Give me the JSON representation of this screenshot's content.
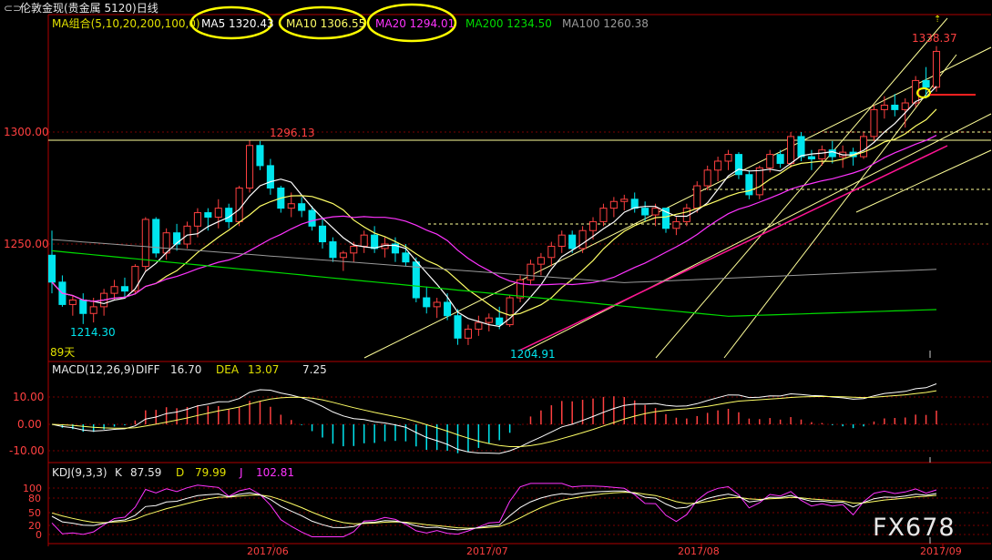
{
  "window": {
    "icon": "link-icon",
    "title": "伦敦金现(贵金属 5120)日线"
  },
  "colors": {
    "up": "#ff4040",
    "down": "#00e5ee",
    "ma5": "#ffffff",
    "ma10": "#ffff66",
    "ma20": "#ff33ff",
    "ma200": "#00dd00",
    "ma100": "#9a9a9a",
    "axis": "#b00000",
    "grid": "#7a0000",
    "hline": "#ffff99",
    "highlight": "#ffff00",
    "watermark": "#e8e8e8"
  },
  "main_panel": {
    "ma_prefix": "MA组合(5,10,20,200,100,0)",
    "ma5_label": "MA5 1320.43",
    "ma10_label": "MA10 1306.55",
    "ma20_label": "MA20 1294.01",
    "ma200_label": "MA200 1234.50",
    "ma100_label": "MA100 1260.38",
    "y_ticks": [
      "1300.00",
      "1250.00"
    ],
    "annotations": {
      "last_high": "1338.37",
      "mid_high": "1296.13",
      "left_low": "1214.30",
      "mid_low": "1204.91",
      "days": "89天",
      "arrow": "⇡"
    }
  },
  "macd_panel": {
    "label": "MACD(12,26,9)",
    "diff_label": "DIFF",
    "diff_value": "16.70",
    "dea_label": "DEA",
    "dea_value": "13.07",
    "macd_value": "7.25",
    "y_ticks": [
      "10.00",
      "0.00",
      "-10.00"
    ]
  },
  "kdj_panel": {
    "label": "KDJ(9,3,3)",
    "k_label": "K",
    "k_value": "87.59",
    "d_label": "D",
    "d_value": "79.99",
    "j_label": "J",
    "j_value": "102.81",
    "y_ticks": [
      "100",
      "80",
      "50",
      "20",
      "0"
    ]
  },
  "x_axis": {
    "labels": [
      "2017/06",
      "2017/07",
      "2017/08",
      "2017/09"
    ]
  },
  "watermark": "FX678",
  "chart_data": {
    "type": "candlestick",
    "ohlc": [
      [
        1245,
        1256,
        1228,
        1233
      ],
      [
        1233,
        1236,
        1222,
        1223
      ],
      [
        1223,
        1227,
        1218,
        1225
      ],
      [
        1225,
        1228,
        1214.3,
        1219
      ],
      [
        1219,
        1226,
        1215,
        1222
      ],
      [
        1222,
        1230,
        1218,
        1228
      ],
      [
        1228,
        1234,
        1225,
        1231
      ],
      [
        1231,
        1235,
        1226,
        1229
      ],
      [
        1229,
        1241,
        1228,
        1240
      ],
      [
        1240,
        1262,
        1238,
        1261
      ],
      [
        1261,
        1262,
        1244,
        1246
      ],
      [
        1246,
        1257,
        1243,
        1255
      ],
      [
        1255,
        1259,
        1247,
        1250
      ],
      [
        1250,
        1260,
        1248,
        1258
      ],
      [
        1258,
        1266,
        1253,
        1264
      ],
      [
        1264,
        1266,
        1256,
        1262
      ],
      [
        1262,
        1270,
        1257,
        1266
      ],
      [
        1266,
        1268,
        1257,
        1260
      ],
      [
        1260,
        1276,
        1258,
        1275
      ],
      [
        1275,
        1296.13,
        1273,
        1294
      ],
      [
        1294,
        1296,
        1283,
        1285
      ],
      [
        1285,
        1288,
        1272,
        1275
      ],
      [
        1275,
        1276,
        1264,
        1266
      ],
      [
        1266,
        1273,
        1262,
        1268
      ],
      [
        1268,
        1271,
        1262,
        1265
      ],
      [
        1265,
        1267,
        1256,
        1258
      ],
      [
        1258,
        1262,
        1248,
        1251
      ],
      [
        1251,
        1253,
        1242,
        1244
      ],
      [
        1244,
        1247,
        1238,
        1246
      ],
      [
        1246,
        1251,
        1242,
        1249
      ],
      [
        1249,
        1256,
        1246,
        1254
      ],
      [
        1254,
        1258,
        1246,
        1248
      ],
      [
        1248,
        1253,
        1244,
        1250
      ],
      [
        1250,
        1253,
        1242,
        1246
      ],
      [
        1246,
        1250,
        1240,
        1242
      ],
      [
        1242,
        1244,
        1224,
        1226
      ],
      [
        1226,
        1231,
        1219,
        1222
      ],
      [
        1222,
        1226,
        1217,
        1224
      ],
      [
        1224,
        1228,
        1216,
        1218
      ],
      [
        1218,
        1221,
        1205,
        1208
      ],
      [
        1208,
        1214,
        1204.91,
        1212
      ],
      [
        1212,
        1218,
        1209,
        1215
      ],
      [
        1215,
        1219,
        1211,
        1217
      ],
      [
        1217,
        1222,
        1212,
        1214
      ],
      [
        1214,
        1227,
        1213,
        1226
      ],
      [
        1226,
        1236,
        1224,
        1234
      ],
      [
        1234,
        1243,
        1232,
        1241
      ],
      [
        1241,
        1246,
        1236,
        1244
      ],
      [
        1244,
        1251,
        1240,
        1249
      ],
      [
        1249,
        1256,
        1246,
        1254
      ],
      [
        1254,
        1256,
        1246,
        1248
      ],
      [
        1248,
        1258,
        1246,
        1256
      ],
      [
        1256,
        1262,
        1252,
        1260
      ],
      [
        1260,
        1268,
        1258,
        1266
      ],
      [
        1266,
        1271,
        1262,
        1269
      ],
      [
        1269,
        1272,
        1265,
        1270
      ],
      [
        1270,
        1273,
        1264,
        1266
      ],
      [
        1266,
        1269,
        1260,
        1263
      ],
      [
        1263,
        1268,
        1258,
        1266
      ],
      [
        1266,
        1266,
        1255,
        1257
      ],
      [
        1257,
        1262,
        1254,
        1260
      ],
      [
        1260,
        1268,
        1258,
        1266
      ],
      [
        1266,
        1278,
        1264,
        1276
      ],
      [
        1276,
        1285,
        1274,
        1283
      ],
      [
        1283,
        1289,
        1278,
        1287
      ],
      [
        1287,
        1292,
        1283,
        1290
      ],
      [
        1290,
        1291,
        1279,
        1281
      ],
      [
        1281,
        1283,
        1270,
        1272
      ],
      [
        1272,
        1285,
        1270,
        1284
      ],
      [
        1284,
        1292,
        1282,
        1290
      ],
      [
        1290,
        1292,
        1284,
        1286
      ],
      [
        1286,
        1300,
        1284,
        1298
      ],
      [
        1298,
        1300,
        1287,
        1289
      ],
      [
        1289,
        1292,
        1283,
        1288
      ],
      [
        1288,
        1294,
        1285,
        1292
      ],
      [
        1292,
        1296,
        1286,
        1289
      ],
      [
        1289,
        1294,
        1284,
        1291
      ],
      [
        1291,
        1293,
        1285,
        1289
      ],
      [
        1289,
        1300,
        1288,
        1298
      ],
      [
        1298,
        1312,
        1296,
        1310
      ],
      [
        1310,
        1316,
        1306,
        1312
      ],
      [
        1312,
        1317,
        1307,
        1310
      ],
      [
        1310,
        1315,
        1302,
        1313
      ],
      [
        1313,
        1325,
        1311,
        1323
      ],
      [
        1323,
        1329,
        1315,
        1320
      ],
      [
        1320,
        1338.37,
        1318,
        1336
      ]
    ],
    "overlays": {
      "MA5": 1320.43,
      "MA10": 1306.55,
      "MA20": 1294.01,
      "MA200": 1234.5,
      "MA100": 1260.38
    },
    "macd": {
      "DIFF": 16.7,
      "DEA": 13.07,
      "MACD": 7.25
    },
    "kdj": {
      "K": 87.59,
      "D": 79.99,
      "J": 102.81
    },
    "ylim": [
      1195,
      1345
    ],
    "x_labels": [
      "2017/06",
      "2017/07",
      "2017/08",
      "2017/09"
    ]
  }
}
